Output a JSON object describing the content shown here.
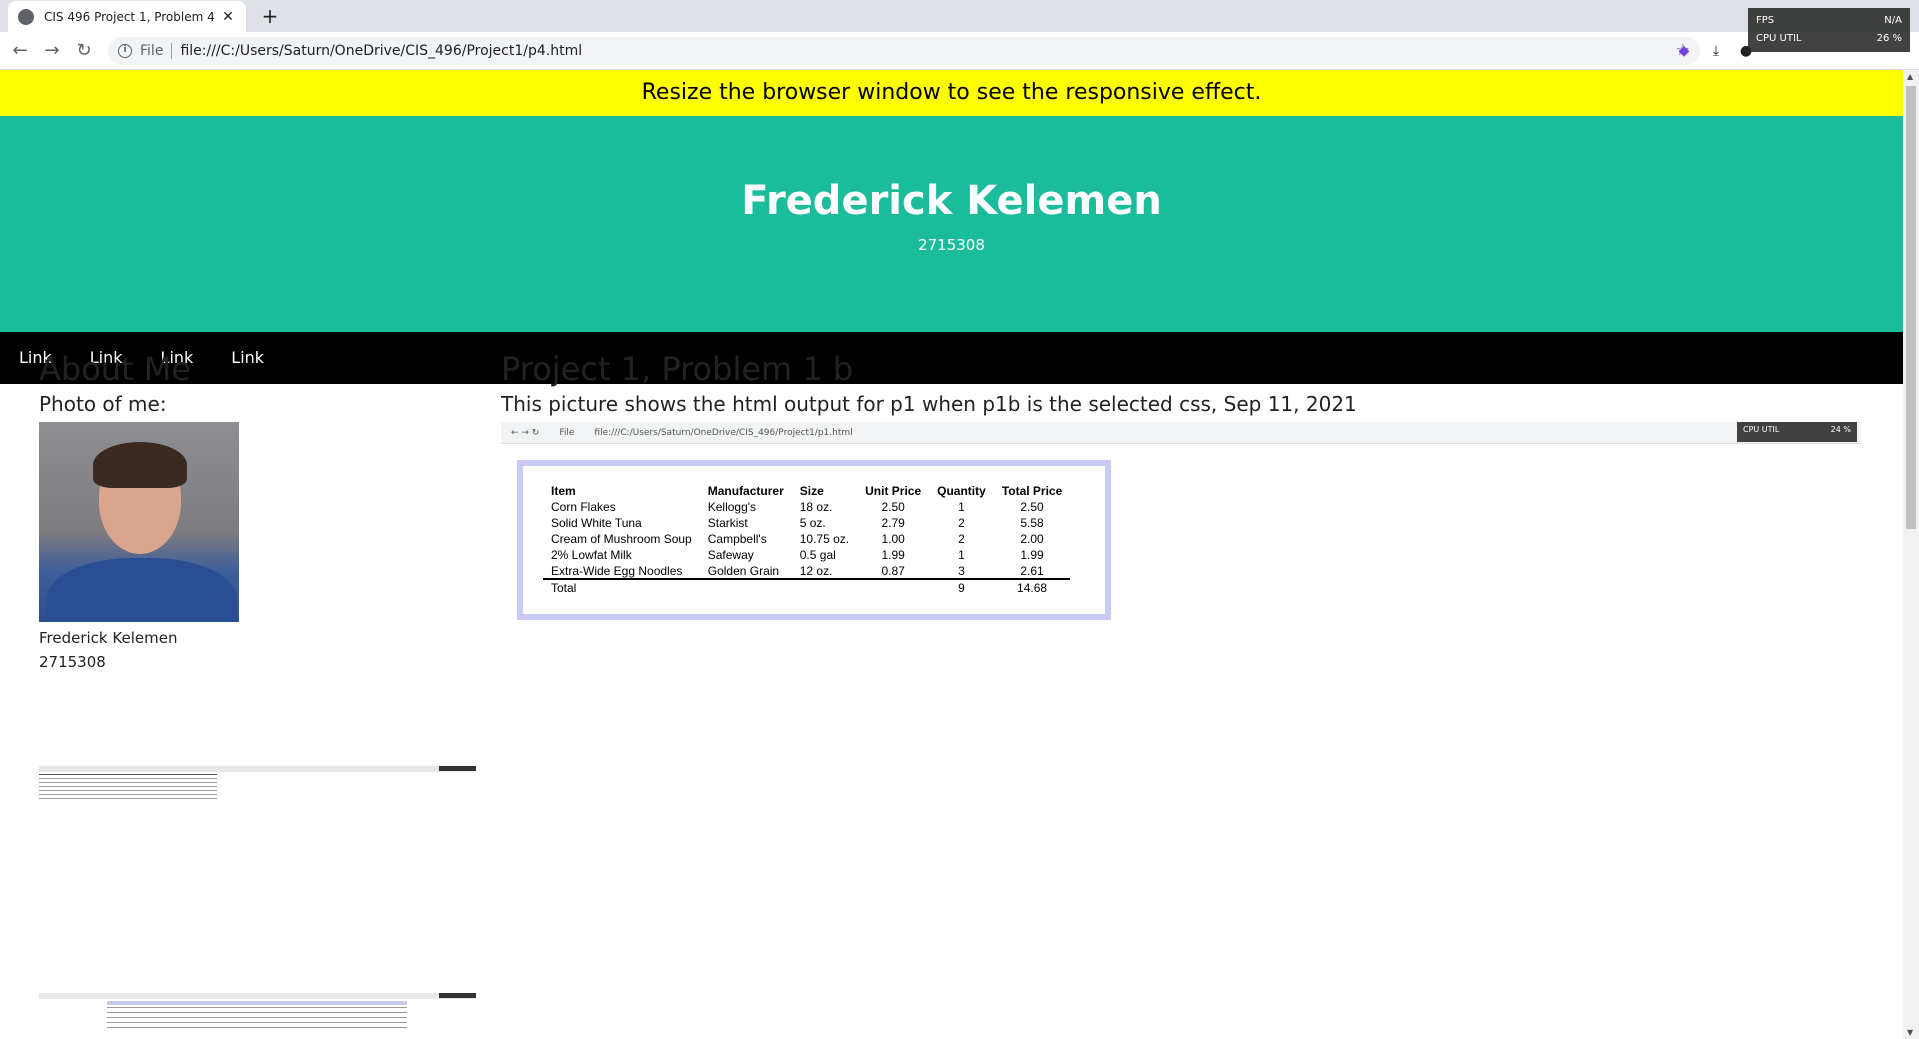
{
  "browser": {
    "tab_title": "CIS 496 Project 1, Problem 4",
    "url_scheme": "File",
    "url": "file:///C:/Users/Saturn/OneDrive/CIS_496/Project1/p4.html",
    "overlay": {
      "fps_label": "FPS",
      "fps_value": "N/A",
      "cpu_label": "CPU UTIL",
      "cpu_value": "26 %"
    }
  },
  "page": {
    "banner": "Resize the browser window to see the responsive effect.",
    "header": {
      "title": "Frederick Kelemen",
      "subtitle": "2715308"
    },
    "nav": [
      "Link",
      "Link",
      "Link",
      "Link"
    ],
    "side": {
      "heading": "About Me",
      "photo_label": "Photo of me:",
      "name": "Frederick Kelemen",
      "id": "2715308"
    },
    "main": {
      "heading": "Project 1, Problem 1 b",
      "caption": "This picture shows the html output for p1 when p1b is the selected css, Sep 11, 2021",
      "shot_scheme": "File",
      "shot_url": "file:///C:/Users/Saturn/OneDrive/CIS_496/Project1/p1.html",
      "shot_cpu_label": "CPU UTIL",
      "shot_cpu_value": "24 %",
      "table": {
        "headers": [
          "Item",
          "Manufacturer",
          "Size",
          "Unit Price",
          "Quantity",
          "Total Price"
        ],
        "rows": [
          [
            "Corn Flakes",
            "Kellogg's",
            "18 oz.",
            "2.50",
            "1",
            "2.50"
          ],
          [
            "Solid White Tuna",
            "Starkist",
            "5 oz.",
            "2.79",
            "2",
            "5.58"
          ],
          [
            "Cream of Mushroom Soup",
            "Campbell's",
            "10.75 oz.",
            "1.00",
            "2",
            "2.00"
          ],
          [
            "2% Lowfat Milk",
            "Safeway",
            "0.5 gal",
            "1.99",
            "1",
            "1.99"
          ],
          [
            "Extra-Wide Egg Noodles",
            "Golden Grain",
            "12 oz.",
            "0.87",
            "3",
            "2.61"
          ]
        ],
        "total": {
          "label": "Total",
          "quantity": "9",
          "total_price": "14.68"
        }
      }
    }
  }
}
